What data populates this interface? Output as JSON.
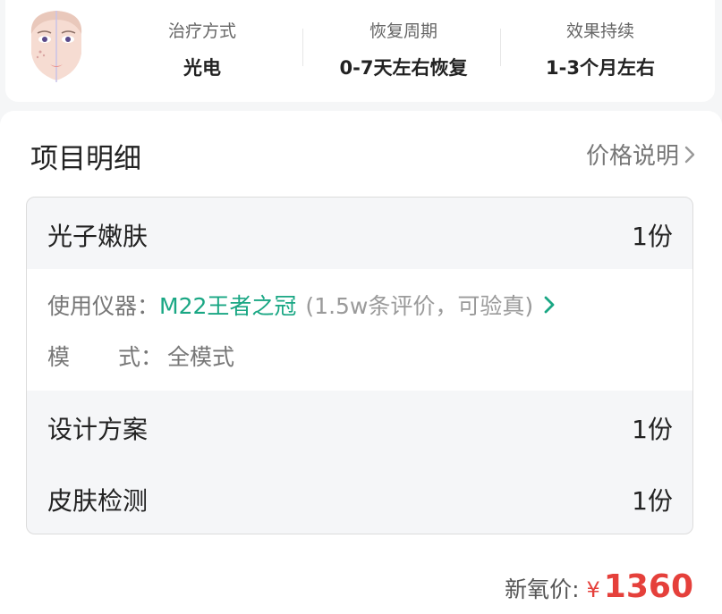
{
  "top": {
    "stats": [
      {
        "label": "治疗方式",
        "value": "光电"
      },
      {
        "label": "恢复周期",
        "value": "0-7天左右恢复"
      },
      {
        "label": "效果持续",
        "value": "1-3个月左右"
      }
    ]
  },
  "section": {
    "title": "项目明细",
    "price_link": "价格说明"
  },
  "items": [
    {
      "name": "光子嫩肤",
      "qty": "1份"
    },
    {
      "name": "设计方案",
      "qty": "1份"
    },
    {
      "name": "皮肤检测",
      "qty": "1份"
    }
  ],
  "detail": {
    "device_label": "使用仪器：",
    "device_name": "M22王者之冠",
    "device_reviews": "(1.5w条评价，可验真)",
    "mode_label_1": "模",
    "mode_label_2": "式：",
    "mode_value": "全模式"
  },
  "footer": {
    "label": "新氧价:",
    "currency": "¥",
    "amount": "1360"
  },
  "colors": {
    "accent_green": "#1aa784",
    "price_red": "#e5403b"
  },
  "icons": [
    "face-illustration-icon",
    "chevron-right-icon"
  ]
}
